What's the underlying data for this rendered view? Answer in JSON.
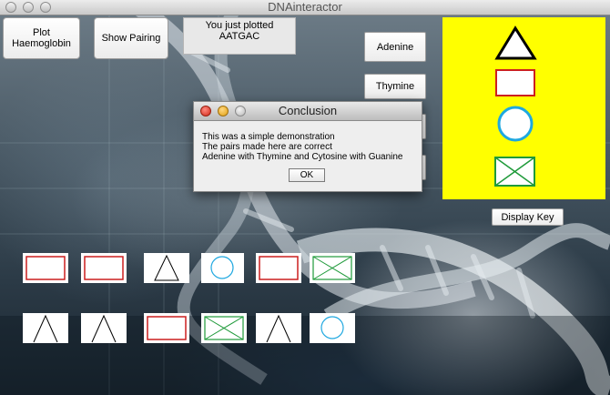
{
  "window": {
    "title": "DNAinteractor"
  },
  "toolbar": {
    "plot_button": "Plot Haemoglobin",
    "pairing_button": "Show Pairing"
  },
  "info": {
    "line1": "You just plotted",
    "line2": "AATGAC"
  },
  "bases": {
    "adenine": "Adenine",
    "thymine": "Thymine"
  },
  "key": {
    "display_button": "Display Key",
    "symbols": [
      "triangle-icon",
      "red-rectangle-icon",
      "blue-circle-icon",
      "green-crossed-box-icon"
    ]
  },
  "dialog": {
    "title": "Conclusion",
    "lines": [
      "This was a simple demonstration",
      "The pairs made here are correct",
      "Adenine with Thymine and Cytosine with Guanine"
    ],
    "ok_label": "OK"
  },
  "sequence_row1": [
    "red-rectangle",
    "red-rectangle",
    "triangle",
    "blue-circle",
    "red-rectangle",
    "green-crossed-box"
  ],
  "sequence_row2": [
    "open-triangle",
    "open-triangle",
    "red-rectangle",
    "green-crossed-box",
    "open-triangle",
    "blue-circle"
  ],
  "colors": {
    "key_panel": "#ffff00",
    "rectangle": "#cc1f1f",
    "circle": "#1fa8e0",
    "crossed_box": "#1f9a3a",
    "triangle": "#000000"
  }
}
